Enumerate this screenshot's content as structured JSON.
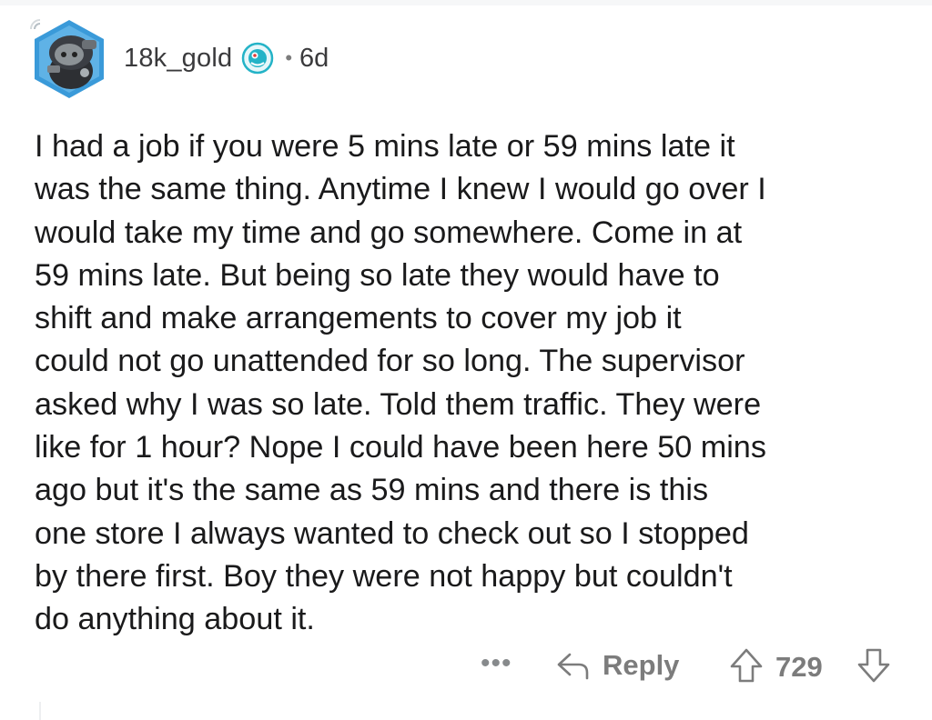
{
  "comment": {
    "username": "18k_gold",
    "separator": "•",
    "age": "6d",
    "body": "I had a job if you were 5 mins late or 59 mins late it\nwas the same thing. Anytime I knew I would go over I\nwould take my time and go somewhere. Come in at\n59 mins late. But being so late they would have to\nshift and make arrangements to cover my job it\ncould not go unattended for so long.  The supervisor\nasked why I was so late. Told them traffic. They were\nlike for 1 hour? Nope I could have been here 50 mins\nago but it's the same as 59 mins and there is this\none store I always wanted to check out so I stopped\nby there first. Boy they were not happy but couldn't\ndo anything about it."
  },
  "actions": {
    "more_label": "•••",
    "reply_label": "Reply",
    "score": "729"
  },
  "icons": {
    "avatar": "snoo-avatar-icon",
    "user_badge": "achievement-badge-icon",
    "reply": "reply-arrow-icon",
    "upvote": "upvote-arrow-icon",
    "downvote": "downvote-arrow-icon",
    "more": "more-options-icon"
  },
  "colors": {
    "text": "#1a1a1b",
    "meta": "#7c7c7c",
    "avatar_bg": "#3a9ad9",
    "badge": "#24b3c7"
  }
}
